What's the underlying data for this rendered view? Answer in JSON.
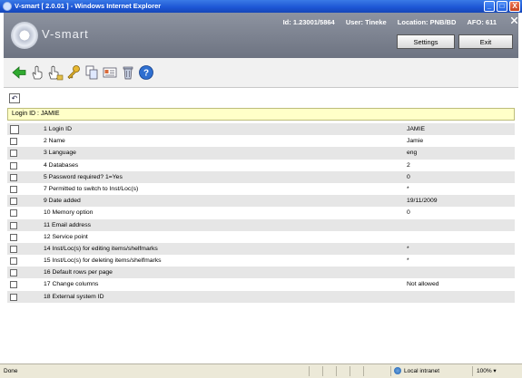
{
  "window": {
    "title": "V-smart [ 2.0.01 ] - Windows Internet Explorer",
    "minimize": "_",
    "maximize": "□",
    "close": "X"
  },
  "header": {
    "logo_text": "V-smart",
    "id_text": "Id: 1.23001/5864",
    "user_text": "User: Tineke",
    "location_text": "Location: PNB/BD",
    "afo_text": "AFO: 611",
    "settings_label": "Settings",
    "exit_label": "Exit"
  },
  "toolbar": {
    "icons": [
      "back-arrow-icon",
      "hand-select-icon",
      "hand-multi-select-icon",
      "key-icon",
      "copy-icon",
      "card-icon",
      "delete-icon",
      "help-icon"
    ]
  },
  "section_title": "Login ID : JAMIE",
  "rows": [
    {
      "label": "1 Login ID",
      "value": "JAMIE"
    },
    {
      "label": "2 Name",
      "value": "Jamie"
    },
    {
      "label": "3 Language",
      "value": "eng"
    },
    {
      "label": "4 Databases",
      "value": "2"
    },
    {
      "label": "5 Password required? 1=Yes",
      "value": "0"
    },
    {
      "label": "7 Permitted to switch to Inst/Loc(s)",
      "value": "*"
    },
    {
      "label": "9 Date added",
      "value": "19/11/2009"
    },
    {
      "label": "10 Memory option",
      "value": "0"
    },
    {
      "label": "11 Email address",
      "value": ""
    },
    {
      "label": "12 Service point",
      "value": ""
    },
    {
      "label": "14 Inst/Loc(s) for editing items/shelfmarks",
      "value": "*"
    },
    {
      "label": "15 Inst/Loc(s) for deleting items/shelfmarks",
      "value": "*"
    },
    {
      "label": "16 Default rows per page",
      "value": ""
    },
    {
      "label": "17 Change columns",
      "value": "Not allowed"
    },
    {
      "label": "18 External system ID",
      "value": ""
    }
  ],
  "status": {
    "left": "Done",
    "zone": "Local intranet",
    "zoom": "100%"
  }
}
